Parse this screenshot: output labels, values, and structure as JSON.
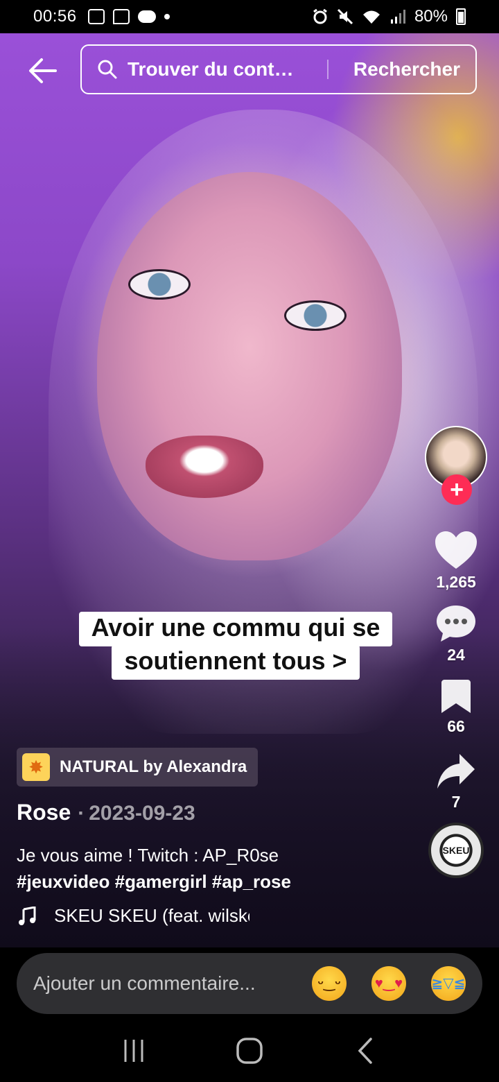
{
  "status_bar": {
    "time": "00:56",
    "battery": "80%",
    "icons": [
      "gallery-icon",
      "twitch-icon",
      "game-controller-icon",
      "notification-dot",
      "alarm-icon",
      "mute-icon",
      "wifi-icon",
      "signal-icon",
      "battery-icon"
    ]
  },
  "search": {
    "placeholder": "Trouver du cont…",
    "button_label": "Rechercher"
  },
  "video": {
    "caption_lines": [
      "Avoir une commu qui se",
      "soutiennent tous >"
    ]
  },
  "actions": {
    "likes": "1,265",
    "comments": "24",
    "saves": "66",
    "shares": "7",
    "follow_symbol": "+",
    "disc_label": "SKEU"
  },
  "info": {
    "effect": "NATURAL by Alexandra",
    "author": "Rose",
    "date_sep": "·",
    "date": "2023-09-23",
    "description": "Je vous aime ! Twitch : AP_R0se",
    "hashtags": "#jeuxvideo #gamergirl #ap_rose",
    "sound": "SKEU SKEU (feat. wilske"
  },
  "comment_bar": {
    "placeholder": "Ajouter un commentaire...",
    "emojis": [
      "grinning-emoji",
      "smiling-hearts-emoji",
      "tears-of-joy-emoji"
    ]
  },
  "colors": {
    "accent": "#fe2c55",
    "input_bg": "#2f2f32",
    "effect_icon_bg": "#fdd35a"
  }
}
